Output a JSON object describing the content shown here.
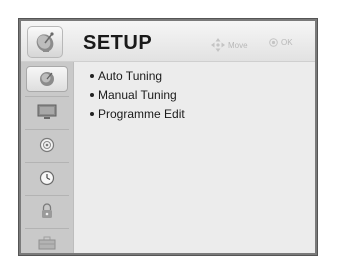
{
  "menu": {
    "title": "SETUP",
    "hint_move": "Move",
    "hint_ok": "OK",
    "header_icon": "satellite-dish-icon"
  },
  "sidebar": {
    "items": [
      {
        "icon": "satellite-dish-icon",
        "active": true
      },
      {
        "icon": "monitor-icon",
        "active": false
      },
      {
        "icon": "speaker-icon",
        "active": false
      },
      {
        "icon": "clock-icon",
        "active": false
      },
      {
        "icon": "lock-icon",
        "active": false
      },
      {
        "icon": "briefcase-icon",
        "active": false
      }
    ]
  },
  "options": [
    {
      "label": "Auto Tuning"
    },
    {
      "label": "Manual Tuning"
    },
    {
      "label": "Programme Edit"
    }
  ],
  "colors": {
    "frame": "#7a7a7a",
    "panel": "#ececec",
    "sidebar": "#c9c9c9",
    "hint": "#b8b8b8"
  }
}
